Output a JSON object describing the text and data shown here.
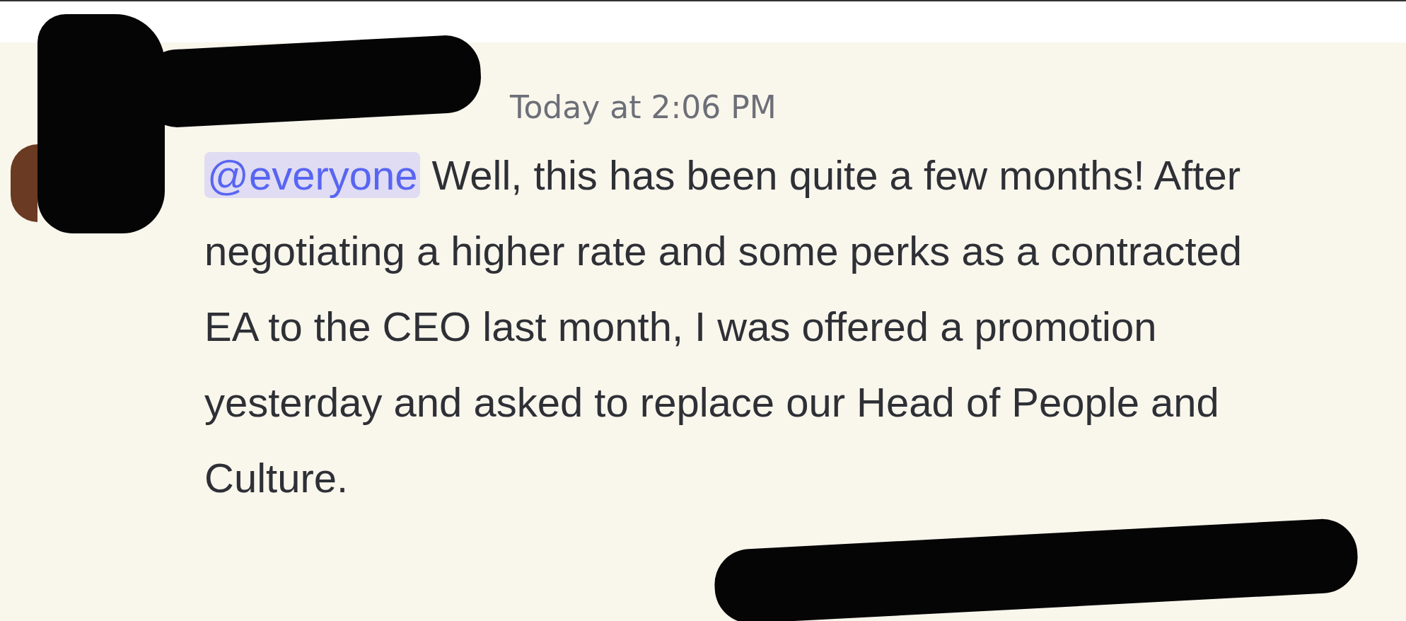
{
  "message": {
    "timestamp": "Today at 2:06 PM",
    "mention": "@everyone",
    "text": "Well, this has been quite a few months! After negotiating a higher rate and some perks as a contracted EA to the CEO last month, I was offered a promotion yesterday and asked to replace our Head of People and Culture."
  }
}
